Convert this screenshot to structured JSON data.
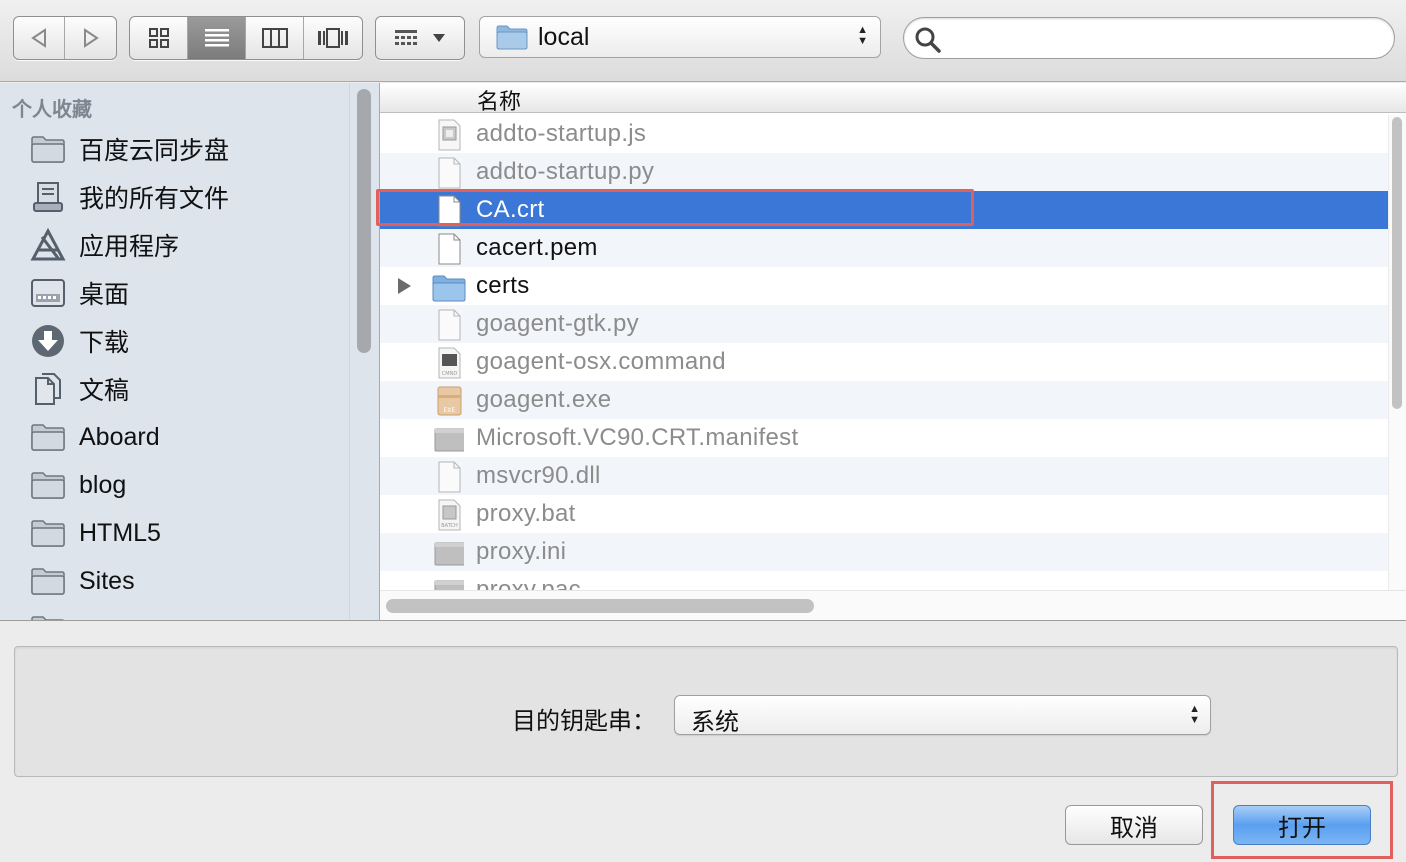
{
  "toolbar": {
    "back_icon": "back-arrow-icon",
    "forward_icon": "forward-arrow-icon",
    "view_modes": [
      "icon-view-icon",
      "list-view-icon",
      "column-view-icon",
      "coverflow-view-icon"
    ],
    "active_view": "list",
    "path_label": "local",
    "search_placeholder": ""
  },
  "sidebar": {
    "header": "个人收藏",
    "items": [
      {
        "label": "百度云同步盘",
        "icon": "folder-icon"
      },
      {
        "label": "我的所有文件",
        "icon": "all-files-icon"
      },
      {
        "label": "应用程序",
        "icon": "applications-icon"
      },
      {
        "label": "桌面",
        "icon": "desktop-icon"
      },
      {
        "label": "下载",
        "icon": "download-icon"
      },
      {
        "label": "文稿",
        "icon": "documents-icon"
      },
      {
        "label": "Aboard",
        "icon": "folder-icon"
      },
      {
        "label": "blog",
        "icon": "folder-icon"
      },
      {
        "label": "HTML5",
        "icon": "folder-icon"
      },
      {
        "label": "Sites",
        "icon": "folder-icon"
      }
    ]
  },
  "filelist": {
    "column_name": "名称",
    "files": [
      {
        "name": "addto-startup.js",
        "icon": "js-file-icon",
        "enabled": false
      },
      {
        "name": "addto-startup.py",
        "icon": "document-icon",
        "enabled": false
      },
      {
        "name": "CA.crt",
        "icon": "document-icon",
        "enabled": true,
        "selected": true
      },
      {
        "name": "cacert.pem",
        "icon": "document-icon",
        "enabled": true
      },
      {
        "name": "certs",
        "icon": "folder-icon",
        "enabled": true,
        "folder": true
      },
      {
        "name": "goagent-gtk.py",
        "icon": "document-icon",
        "enabled": false
      },
      {
        "name": "goagent-osx.command",
        "icon": "command-file-icon",
        "enabled": false
      },
      {
        "name": "goagent.exe",
        "icon": "exe-file-icon",
        "enabled": false
      },
      {
        "name": "Microsoft.VC90.CRT.manifest",
        "icon": "generic-file-icon",
        "enabled": false
      },
      {
        "name": "msvcr90.dll",
        "icon": "document-icon",
        "enabled": false
      },
      {
        "name": "proxy.bat",
        "icon": "batch-file-icon",
        "enabled": false
      },
      {
        "name": "proxy.ini",
        "icon": "generic-file-icon",
        "enabled": false
      },
      {
        "name": "proxy.pac",
        "icon": "generic-file-icon",
        "enabled": false
      }
    ]
  },
  "options": {
    "keychain_label": "目的钥匙串：",
    "keychain_value": "系统"
  },
  "buttons": {
    "cancel": "取消",
    "open": "打开"
  },
  "colors": {
    "selection": "#3b77d7",
    "sidebar_bg": "#dde4ec",
    "annotation_red": "#e0605c",
    "default_button": "#5a9ff0"
  }
}
